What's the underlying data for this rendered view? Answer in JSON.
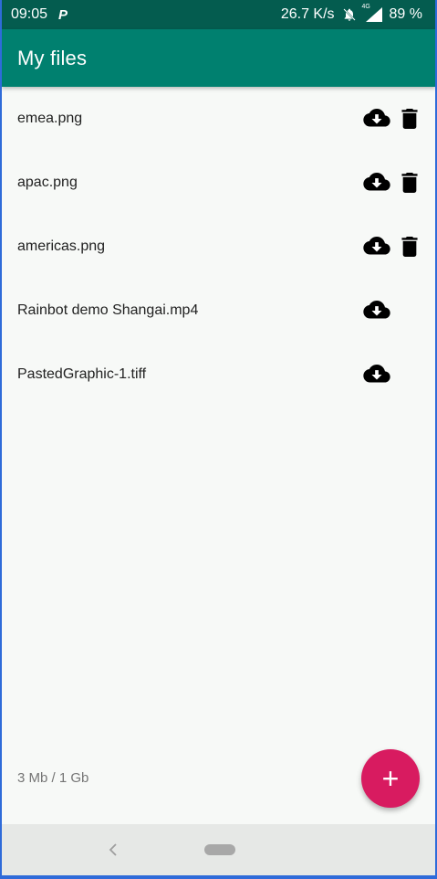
{
  "status_bar": {
    "time": "09:05",
    "speed": "26.7 K/s",
    "battery": "89 %",
    "network_label": "4G"
  },
  "app_bar": {
    "title": "My files"
  },
  "files": [
    {
      "name": "emea.png",
      "can_delete": true
    },
    {
      "name": "apac.png",
      "can_delete": true
    },
    {
      "name": "americas.png",
      "can_delete": true
    },
    {
      "name": "Rainbot demo Shangai.mp4",
      "can_delete": false
    },
    {
      "name": "PastedGraphic-1.tiff",
      "can_delete": false
    }
  ],
  "storage": {
    "usage": "3 Mb / 1 Gb"
  },
  "fab": {
    "label": "+"
  },
  "icons": {
    "download": "cloud-download-icon",
    "delete": "trash-icon",
    "add": "plus-icon",
    "back": "back-chevron-icon"
  },
  "colors": {
    "status_bar": "#045c4f",
    "app_bar": "#00806f",
    "fab": "#d81b60",
    "background": "#f7f9f7"
  }
}
